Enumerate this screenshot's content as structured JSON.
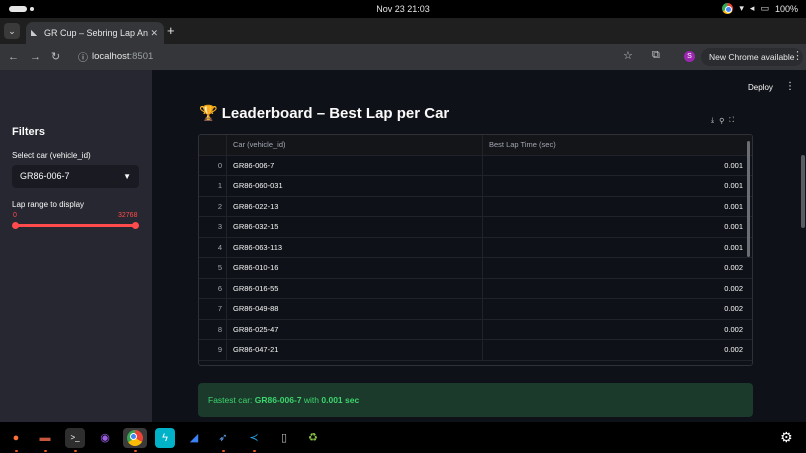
{
  "system": {
    "clock": "Nov 23  21:03",
    "battery": "100%"
  },
  "browser": {
    "tab_title": "GR Cup – Sebring Lap An",
    "url_host": "localhost",
    "url_port": ":8501",
    "new_chrome_label": "New Chrome available",
    "profile_initial": "S"
  },
  "app": {
    "deploy_label": "Deploy",
    "sidebar": {
      "title": "Filters",
      "select_label": "Select car (vehicle_id)",
      "select_value": "GR86-006-7",
      "slider_label": "Lap range to display",
      "slider_min": "0",
      "slider_max": "32768"
    },
    "page_title": "Leaderboard – Best Lap per Car",
    "table": {
      "columns": [
        "Car (vehicle_id)",
        "Best Lap Time (sec)"
      ],
      "rows": [
        {
          "idx": "0",
          "car": "GR86-006-7",
          "time": "0.001"
        },
        {
          "idx": "1",
          "car": "GR86-060-031",
          "time": "0.001"
        },
        {
          "idx": "2",
          "car": "GR86-022-13",
          "time": "0.001"
        },
        {
          "idx": "3",
          "car": "GR86-032-15",
          "time": "0.001"
        },
        {
          "idx": "4",
          "car": "GR86-063-113",
          "time": "0.001"
        },
        {
          "idx": "5",
          "car": "GR86-010-16",
          "time": "0.002"
        },
        {
          "idx": "6",
          "car": "GR86-016-55",
          "time": "0.002"
        },
        {
          "idx": "7",
          "car": "GR86-049-88",
          "time": "0.002"
        },
        {
          "idx": "8",
          "car": "GR86-025-47",
          "time": "0.002"
        },
        {
          "idx": "9",
          "car": "GR86-047-21",
          "time": "0.002"
        }
      ]
    },
    "success": {
      "prefix": "Fastest car: ",
      "car": "GR86-006-7",
      "middle": " with ",
      "time": "0.001 sec"
    }
  },
  "taskbar": {
    "apps": [
      "firefox-icon",
      "files-icon",
      "terminal-icon",
      "tor-icon",
      "chrome-icon",
      "bolt-icon",
      "shark-icon",
      "bird-icon",
      "vscode-icon",
      "drive-icon",
      "trash-icon"
    ]
  }
}
